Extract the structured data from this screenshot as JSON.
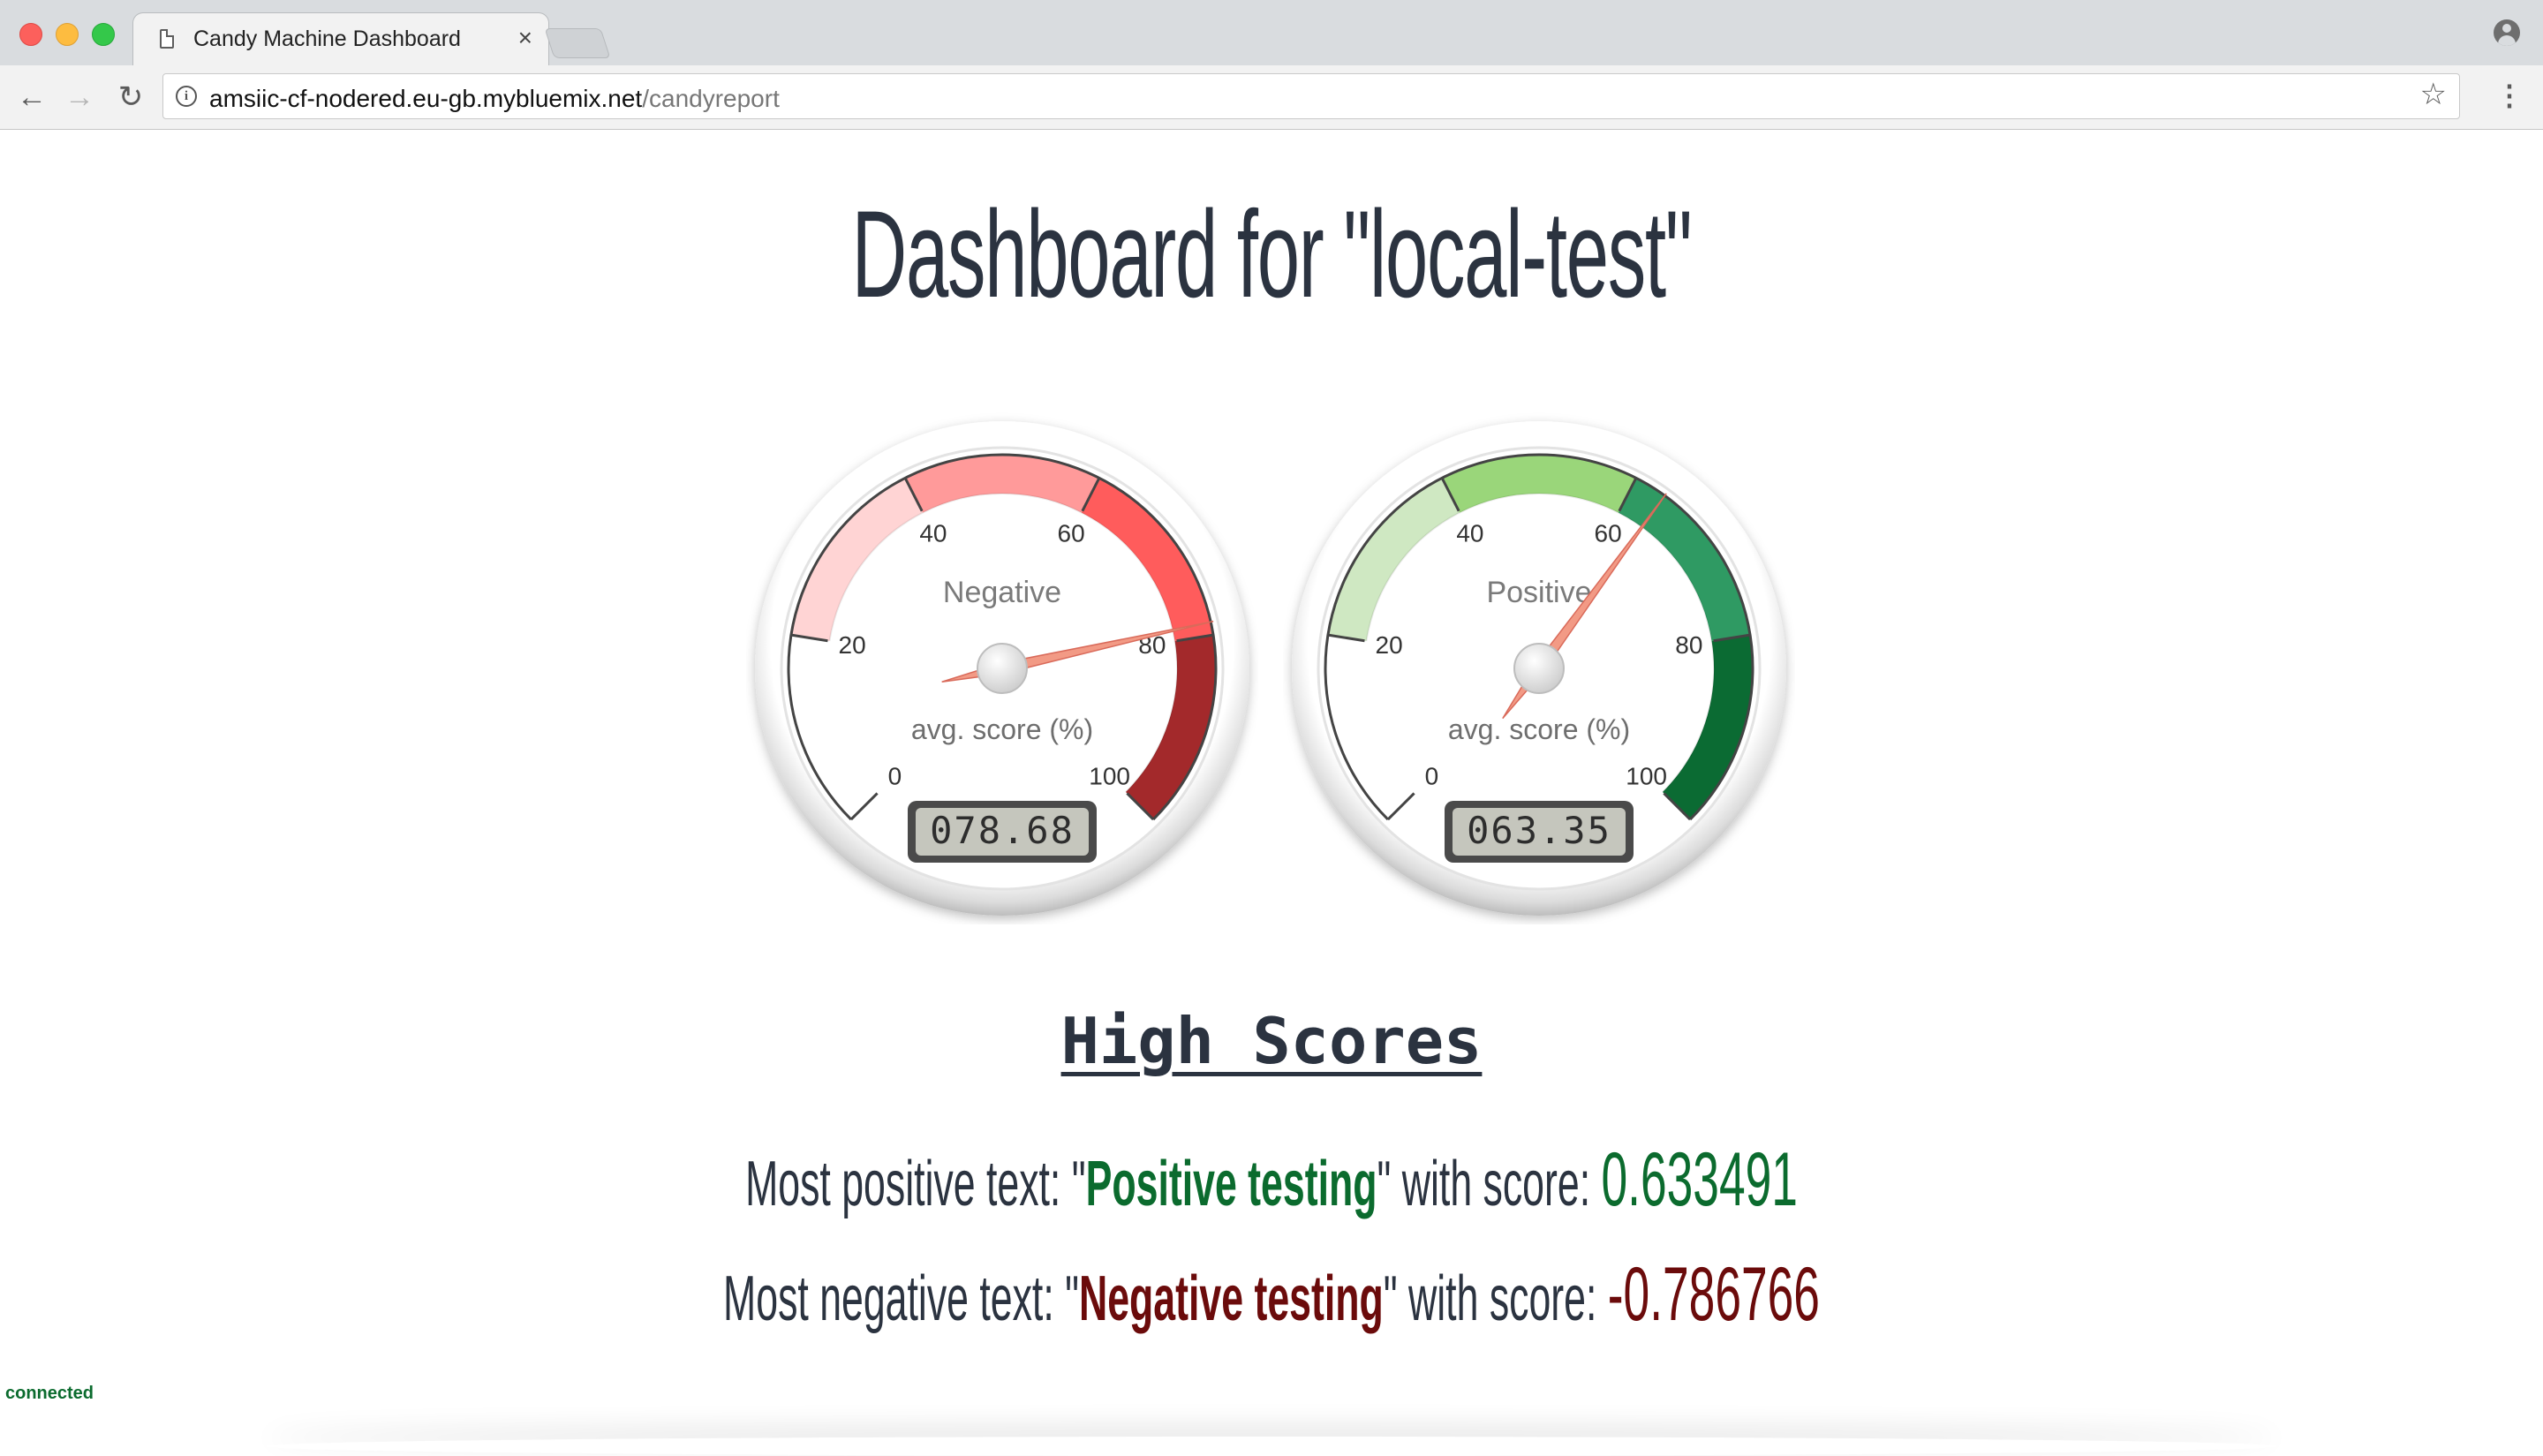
{
  "browser": {
    "tab_title": "Candy Machine Dashboard",
    "tab_close": "×",
    "url_host": "amsiic-cf-nodered.eu-gb.mybluemix.net",
    "url_path": "/candyreport"
  },
  "page": {
    "title": "Dashboard for \"local-test\""
  },
  "gauges": [
    {
      "label": "Negative",
      "unit_label": "avg. score (%)",
      "ticks": [
        "0",
        "20",
        "40",
        "60",
        "80",
        "100"
      ],
      "value": 78.68,
      "display": "078.68",
      "band_colors": [
        "#ffd4d4",
        "#ff9a9a",
        "#ff5c5c",
        "#a3292b"
      ]
    },
    {
      "label": "Positive",
      "unit_label": "avg. score (%)",
      "ticks": [
        "0",
        "20",
        "40",
        "60",
        "80",
        "100"
      ],
      "value": 63.35,
      "display": "063.35",
      "band_colors": [
        "#cfe8c2",
        "#9ad67a",
        "#2f9a63",
        "#0b6b33"
      ]
    }
  ],
  "high_scores": {
    "title": "High Scores",
    "positive": {
      "prefix": "Most positive text: ",
      "open_quote": "\"",
      "text": "Positive testing",
      "close_quote": "\"",
      "mid": " with score: ",
      "score": "0.633491"
    },
    "negative": {
      "prefix": "Most negative text: ",
      "open_quote": "\"",
      "text": "Negative testing",
      "close_quote": "\"",
      "mid": " with score: ",
      "score": "-0.786766"
    }
  },
  "status": "connected"
}
